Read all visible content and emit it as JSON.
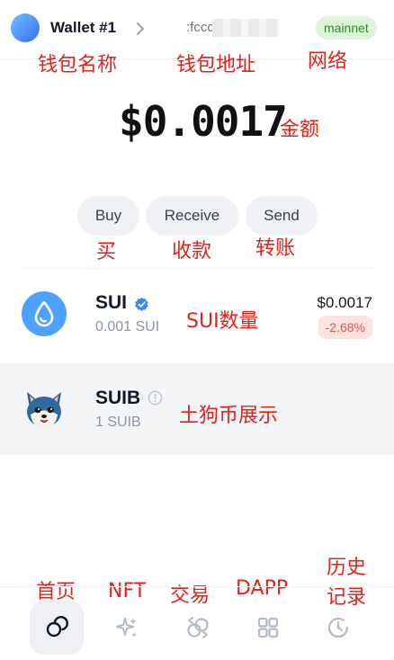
{
  "header": {
    "wallet_name": "Wallet #1",
    "address_prefix": ":fccc",
    "network": "mainnet"
  },
  "balance": "$0.0017",
  "actions": {
    "buy": "Buy",
    "receive": "Receive",
    "send": "Send"
  },
  "tokens": [
    {
      "symbol": "SUI",
      "amount": "0.001 SUI",
      "value": "$0.0017",
      "change": "-2.68%",
      "verified": true
    },
    {
      "symbol": "SUIB",
      "amount": "1 SUIB",
      "verified": false
    }
  ],
  "annotations": {
    "wallet_name": "钱包名称",
    "wallet_address": "钱包地址",
    "network": "网络",
    "amount": "金额",
    "buy": "买",
    "receive": "收款",
    "send": "转账",
    "sui_quantity": "SUI数量",
    "suib_display": "土狗币展示",
    "home": "首页",
    "nft": "NFT",
    "trade": "交易",
    "dapp": "DAPP",
    "history_line1": "历史",
    "history_line2": "记录"
  },
  "nav": [
    {
      "id": "home",
      "icon": "home-rings-icon",
      "active": true
    },
    {
      "id": "nft",
      "icon": "sparkle-icon",
      "active": false
    },
    {
      "id": "swap",
      "icon": "swap-icon",
      "active": false
    },
    {
      "id": "apps",
      "icon": "grid-icon",
      "active": false
    },
    {
      "id": "activity",
      "icon": "clock-icon",
      "active": false
    }
  ],
  "colors": {
    "network_bg": "#dcf5d6",
    "network_text": "#2f8a2b",
    "sui_blue": "#4da2ff",
    "negative": "#e25555",
    "annotation": "#e0231b"
  }
}
